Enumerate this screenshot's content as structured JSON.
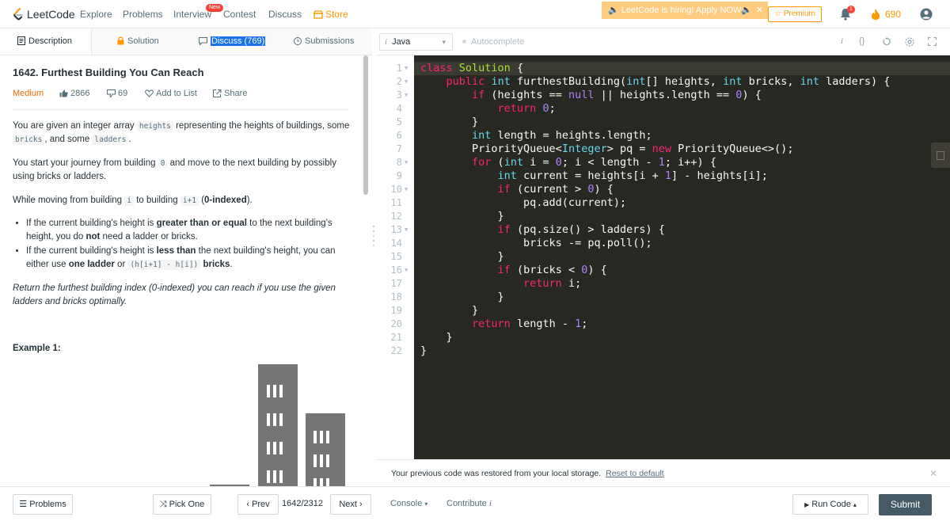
{
  "nav": {
    "logo_text": "LeetCode",
    "items": [
      "Explore",
      "Problems",
      "Interview",
      "Contest",
      "Discuss"
    ],
    "new_badge": "New",
    "store": "Store",
    "hiring_banner": "LeetCode is hiring! Apply NOW",
    "premium": "Premium",
    "notification_count": "1",
    "coins": "690"
  },
  "left_tabs": {
    "description": "Description",
    "solution": "Solution",
    "discuss": "Discuss (769)",
    "submissions": "Submissions"
  },
  "problem": {
    "title": "1642. Furthest Building You Can Reach",
    "difficulty": "Medium",
    "likes": "2866",
    "dislikes": "69",
    "add_to_list": "Add to List",
    "share": "Share",
    "p1": {
      "a": "You are given an integer array ",
      "c1": "heights",
      "b": " representing the heights of buildings, some ",
      "c2": "bricks",
      "d": ", and some ",
      "c3": "ladders",
      "e": "."
    },
    "p2": {
      "a": "You start your journey from building ",
      "c1": "0",
      "b": " and move to the next building by possibly using bricks or ladders."
    },
    "p3": {
      "a": "While moving from building ",
      "c1": "i",
      "b": " to building ",
      "c2": "i+1",
      "c": " (",
      "bold": "0-indexed",
      "d": ")."
    },
    "bullet1": {
      "a": "If the current building's height is ",
      "bold1": "greater than or equal",
      "b": " to the next building's height, you do ",
      "bold2": "not",
      "c": " need a ladder or bricks."
    },
    "bullet2": {
      "a": "If the current building's height is ",
      "bold1": "less than",
      "b": " the next building's height, you can either use ",
      "bold2": "one ladder",
      "c": " or ",
      "code": "(h[i+1] - h[i])",
      "d": " ",
      "bold3": "bricks",
      "e": "."
    },
    "return_text": "Return the furthest building index (0-indexed) you can reach if you use the given ladders and bricks optimally.",
    "example_label": "Example 1:"
  },
  "editor": {
    "language": "Java",
    "autocomplete": "Autocomplete",
    "line_numbers": [
      "1",
      "2",
      "3",
      "4",
      "5",
      "6",
      "7",
      "8",
      "9",
      "10",
      "11",
      "12",
      "13",
      "14",
      "15",
      "16",
      "17",
      "18",
      "19",
      "20",
      "21",
      "22"
    ],
    "restore_msg": "Your previous code was restored from your local storage.",
    "reset_link": "Reset to default"
  },
  "bottom": {
    "problems": "Problems",
    "pick_one": "Pick One",
    "prev": "Prev",
    "page": "1642/2312",
    "next": "Next",
    "console": "Console",
    "contribute": "Contribute",
    "run_code": "Run Code",
    "submit": "Submit"
  },
  "colors": {
    "accent_orange": "#ff9800",
    "difficulty_medium": "#ef6c00",
    "editor_bg": "#272822",
    "submit_bg": "#455a64"
  }
}
